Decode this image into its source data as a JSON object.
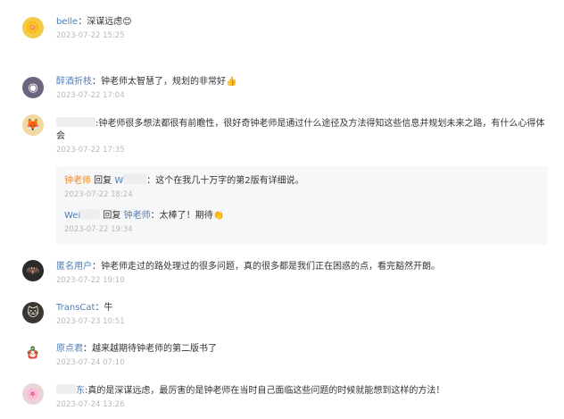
{
  "comments": [
    {
      "name": "belle",
      "sep": "：",
      "text": "深谋远虑",
      "emoji": "😊",
      "time": "2023-07-22 15:25"
    },
    {
      "name": "醉酒折枝",
      "sep": "：",
      "text": "钟老师太智慧了，规划的非常好",
      "emoji": "👍",
      "time": "2023-07-22 17:04"
    },
    {
      "name": "",
      "sep": ":",
      "text": "钟老师很多想法都很有前瞻性，很好奇钟老师是通过什么途径及方法得知这些信息并规划未来之路，有什么心得体会",
      "time": "2023-07-22 17:35"
    },
    {
      "name": "匿名用户",
      "sep": "：",
      "text": "钟老师走过的路处理过的很多问题，真的很多都是我们正在困惑的点，看完豁然开朗。",
      "time": "2023-07-22 19:10"
    },
    {
      "name": "TransCat",
      "sep": "：",
      "text": "牛",
      "time": "2023-07-23 10:51"
    },
    {
      "name": "原点君",
      "sep": "：",
      "text": "越来越期待钟老师的第二版书了",
      "time": "2023-07-24 07:10"
    },
    {
      "name": "",
      "name_tail": "东",
      "sep": ":",
      "text": "真的是深谋远虑，最厉害的是钟老师在当时自己面临这些问题的时候就能想到这样的方法！",
      "time": "2023-07-24 13:26"
    }
  ],
  "replies": [
    {
      "from": "钟老师",
      "verb": " 回复 ",
      "to": "W",
      "sep": "：",
      "text": "这个在我几十万字的第2版有详细说。",
      "time": "2023-07-22 18:24"
    },
    {
      "from": "Wei",
      "verb": " 回复 ",
      "to": "钟老师",
      "sep": "：",
      "text": "太棒了！期待",
      "emoji": "👏",
      "time": "2023-07-22 19:34"
    }
  ],
  "avatar_icons": [
    "flower-avatar-icon",
    "photo-avatar-icon",
    "cartoon-avatar-icon",
    "batman-avatar-icon",
    "cat-avatar-icon",
    "figurine-avatar-icon",
    "flower-avatar-icon"
  ],
  "colors": {
    "name": "#4f7db3",
    "reply_author": "#f08a2a",
    "timestamp": "#b9b9b9",
    "reply_bg": "#f6f7f9"
  }
}
